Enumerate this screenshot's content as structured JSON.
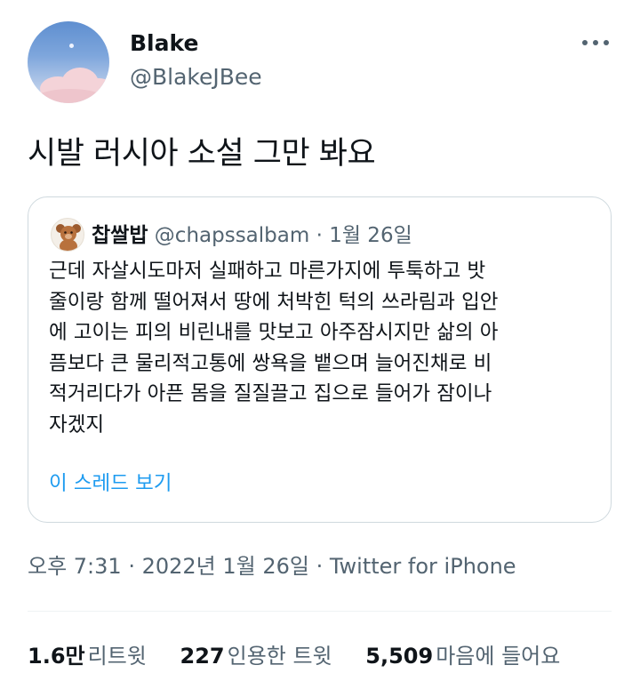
{
  "author": {
    "display_name": "Blake",
    "handle": "@BlakeJBee"
  },
  "tweet": {
    "text": "시발 러시아 소설 그만 봐요"
  },
  "quote": {
    "name": "찹쌀밥",
    "handle": "@chapssalbam",
    "separator": " · ",
    "date": "1월 26일",
    "lines": [
      "근데 자살시도마저 실패하고 마른가지에 투툭하고 밧",
      "줄이랑 함께 떨어져서 땅에 처박힌 턱의 쓰라림과 입안",
      "에 고이는 피의 비린내를 맛보고 아주잠시지만 삶의 아",
      "픔보다 큰 물리적고통에 쌍욕을 뱉으며 늘어진채로 비",
      "적거리다가 아픈 몸을 질질끌고 집으로 들어가 잠이나",
      "자겠지"
    ],
    "thread_link": "이 스레드 보기"
  },
  "meta": {
    "time": "오후 7:31",
    "separator": " · ",
    "date": "2022년 1월 26일",
    "source": "Twitter for iPhone"
  },
  "stats": {
    "retweets": {
      "count": "1.6만",
      "label": "리트윗"
    },
    "quotes": {
      "count": "227",
      "label": "인용한 트윗"
    },
    "likes": {
      "count": "5,509",
      "label": "마음에 들어요"
    }
  },
  "colors": {
    "text": "#0f1419",
    "secondary": "#536471",
    "link": "#1d9bf0",
    "border": "#cfd9de"
  }
}
